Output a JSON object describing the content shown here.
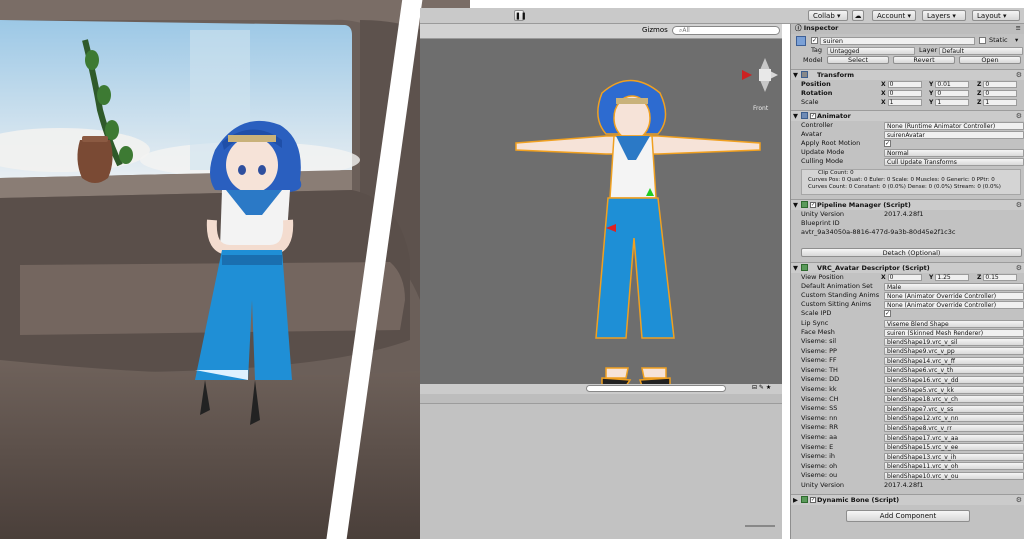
{
  "toolbar": {
    "collab": "Collab",
    "account": "Account",
    "layers": "Layers",
    "layout": "Layout"
  },
  "scene": {
    "gizmos": "Gizmos",
    "search_placeholder": "All",
    "view_label": "Front"
  },
  "inspector": {
    "tab": "Inspector",
    "object_name": "suiren",
    "static_label": "Static",
    "tag_label": "Tag",
    "tag_value": "Untagged",
    "layer_label": "Layer",
    "layer_value": "Default",
    "model_label": "Model",
    "model_select": "Select",
    "model_revert": "Revert",
    "model_open": "Open",
    "transform": {
      "title": "Transform",
      "rows": [
        {
          "label": "Position",
          "x": "0",
          "y": "0.01",
          "z": "0"
        },
        {
          "label": "Rotation",
          "x": "0",
          "y": "0",
          "z": "0"
        },
        {
          "label": "Scale",
          "x": "1",
          "y": "1",
          "z": "1"
        }
      ]
    },
    "animator": {
      "title": "Animator",
      "controller_label": "Controller",
      "controller_value": "None (Runtime Animator Controller)",
      "avatar_label": "Avatar",
      "avatar_value": "suirenAvatar",
      "root_motion_label": "Apply Root Motion",
      "update_mode_label": "Update Mode",
      "update_mode_value": "Normal",
      "culling_mode_label": "Culling Mode",
      "culling_mode_value": "Cull Update Transforms",
      "clip_lines": [
        "Clip Count: 0",
        "Curves Pos: 0 Quat: 0 Euler: 0 Scale: 0 Muscles: 0 Generic: 0 PPtr: 0",
        "Curves Count: 0 Constant: 0 (0.0%) Dense: 0 (0.0%) Stream: 0 (0.0%)"
      ]
    },
    "pipeline": {
      "title": "Pipeline Manager (Script)",
      "unity_version_label": "Unity Version",
      "unity_version_value": "2017.4.28f1",
      "blueprint_label": "Blueprint ID",
      "blueprint_value": "avtr_9a34050a-8816-477d-9a3b-80d45e2f1c3c",
      "detach_button": "Detach (Optional)"
    },
    "descriptor": {
      "title": "VRC_Avatar Descriptor (Script)",
      "view_position_label": "View Position",
      "view_x": "0",
      "view_y": "1.25",
      "view_z": "0.15",
      "default_anim_label": "Default Animation Set",
      "default_anim_value": "Male",
      "standing_label": "Custom Standing Anims",
      "standing_value": "None (Animator Override Controller)",
      "sitting_label": "Custom Sitting Anims",
      "sitting_value": "None (Animator Override Controller)",
      "scale_ipd_label": "Scale IPD",
      "lip_sync_label": "Lip Sync",
      "lip_sync_value": "Viseme Blend Shape",
      "face_mesh_label": "Face Mesh",
      "face_mesh_value": "suiren (Skinned Mesh Renderer)",
      "visemes": [
        {
          "label": "Viseme: sil",
          "value": "blendShape19.vrc_v_sil"
        },
        {
          "label": "Viseme: PP",
          "value": "blendShape9.vrc_v_pp"
        },
        {
          "label": "Viseme: FF",
          "value": "blendShape14.vrc_v_ff"
        },
        {
          "label": "Viseme: TH",
          "value": "blendShape6.vrc_v_th"
        },
        {
          "label": "Viseme: DD",
          "value": "blendShape16.vrc_v_dd"
        },
        {
          "label": "Viseme: kk",
          "value": "blendShape5.vrc_v_kk"
        },
        {
          "label": "Viseme: CH",
          "value": "blendShape18.vrc_v_ch"
        },
        {
          "label": "Viseme: SS",
          "value": "blendShape7.vrc_v_ss"
        },
        {
          "label": "Viseme: nn",
          "value": "blendShape12.vrc_v_nn"
        },
        {
          "label": "Viseme: RR",
          "value": "blendShape8.vrc_v_rr"
        },
        {
          "label": "Viseme: aa",
          "value": "blendShape17.vrc_v_aa"
        },
        {
          "label": "Viseme: E",
          "value": "blendShape15.vrc_v_ee"
        },
        {
          "label": "Viseme: ih",
          "value": "blendShape13.vrc_v_ih"
        },
        {
          "label": "Viseme: oh",
          "value": "blendShape11.vrc_v_oh"
        },
        {
          "label": "Viseme: ou",
          "value": "blendShape10.vrc_v_ou"
        }
      ],
      "unity_version_label": "Unity Version",
      "unity_version_value": "2017.4.28f1"
    },
    "dynamic_bone": {
      "title": "Dynamic Bone (Script)"
    },
    "add_component": "Add Component"
  }
}
